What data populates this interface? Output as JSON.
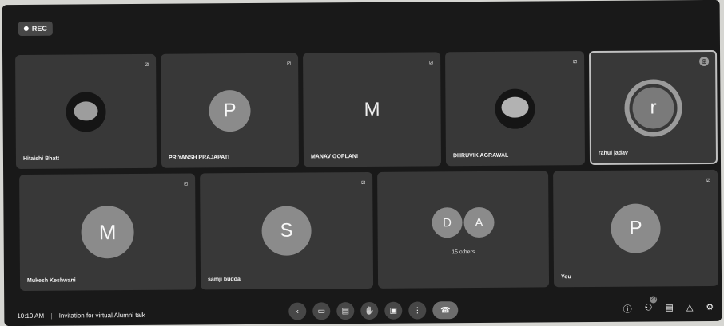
{
  "recording": {
    "label": "REC"
  },
  "top_row": [
    {
      "name": "Hitaishi Bhatt",
      "type": "photo"
    },
    {
      "name": "PRIYANSH PRAJAPATI",
      "type": "initial",
      "initial": "P"
    },
    {
      "name": "MANAV GOPLANI",
      "type": "letter",
      "initial": "M"
    },
    {
      "name": "DHRUVIK AGRAWAL",
      "type": "photo"
    },
    {
      "name": "rahul jadav",
      "type": "ring",
      "initial": "r",
      "active": true
    }
  ],
  "bottom_row": [
    {
      "name": "Mukesh Keshwani",
      "type": "initial",
      "initial": "M"
    },
    {
      "name": "samji budda",
      "type": "initial",
      "initial": "S"
    },
    {
      "name": "",
      "type": "group",
      "initials": [
        "D",
        "A"
      ],
      "others_label": "15 others"
    },
    {
      "name": "You",
      "type": "initial",
      "initial": "P"
    }
  ],
  "meeting": {
    "time": "10:10 AM",
    "title": "Invitation for virtual Alumni talk"
  },
  "controls": [
    {
      "icon": "arrow-icon",
      "glyph": "‹"
    },
    {
      "icon": "camera-icon",
      "glyph": "▭"
    },
    {
      "icon": "captions-icon",
      "glyph": "▤"
    },
    {
      "icon": "raise-hand-icon",
      "glyph": "✋"
    },
    {
      "icon": "present-icon",
      "glyph": "▣"
    },
    {
      "icon": "more-options-icon",
      "glyph": "⋮"
    },
    {
      "icon": "end-call-icon",
      "glyph": "☎"
    }
  ],
  "right_icons": [
    {
      "icon": "info-icon",
      "glyph": "ⓘ"
    },
    {
      "icon": "people-icon",
      "glyph": "⚇",
      "count": "20"
    },
    {
      "icon": "chat-icon",
      "glyph": "▤"
    },
    {
      "icon": "activities-icon",
      "glyph": "△"
    },
    {
      "icon": "host-controls-icon",
      "glyph": "⚙"
    }
  ]
}
